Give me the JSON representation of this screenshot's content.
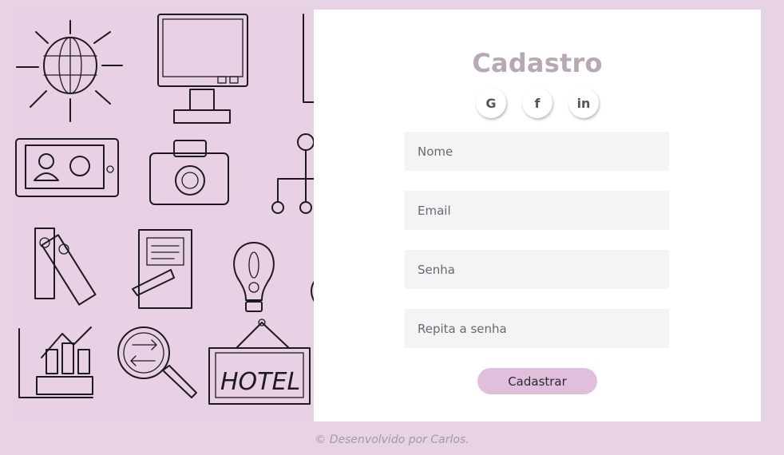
{
  "form": {
    "title": "Cadastro",
    "social": [
      {
        "label": "G",
        "icon": "google-icon"
      },
      {
        "label": "f",
        "icon": "facebook-icon"
      },
      {
        "label": "in",
        "icon": "linkedin-icon"
      }
    ],
    "fields": {
      "name_placeholder": "Nome",
      "email_placeholder": "Email",
      "password_placeholder": "Senha",
      "repeat_password_placeholder": "Repita a senha"
    },
    "submit_label": "Cadastrar"
  },
  "illustration": {
    "hotel_sign_text": "HOTEL"
  },
  "footer": {
    "credit": "© Desenvolvido por Carlos."
  },
  "colors": {
    "page_background": "#e8d3e5",
    "title": "#b8a8b5",
    "submit_button": "#e2bedd",
    "input_background": "#f4f4f6"
  }
}
